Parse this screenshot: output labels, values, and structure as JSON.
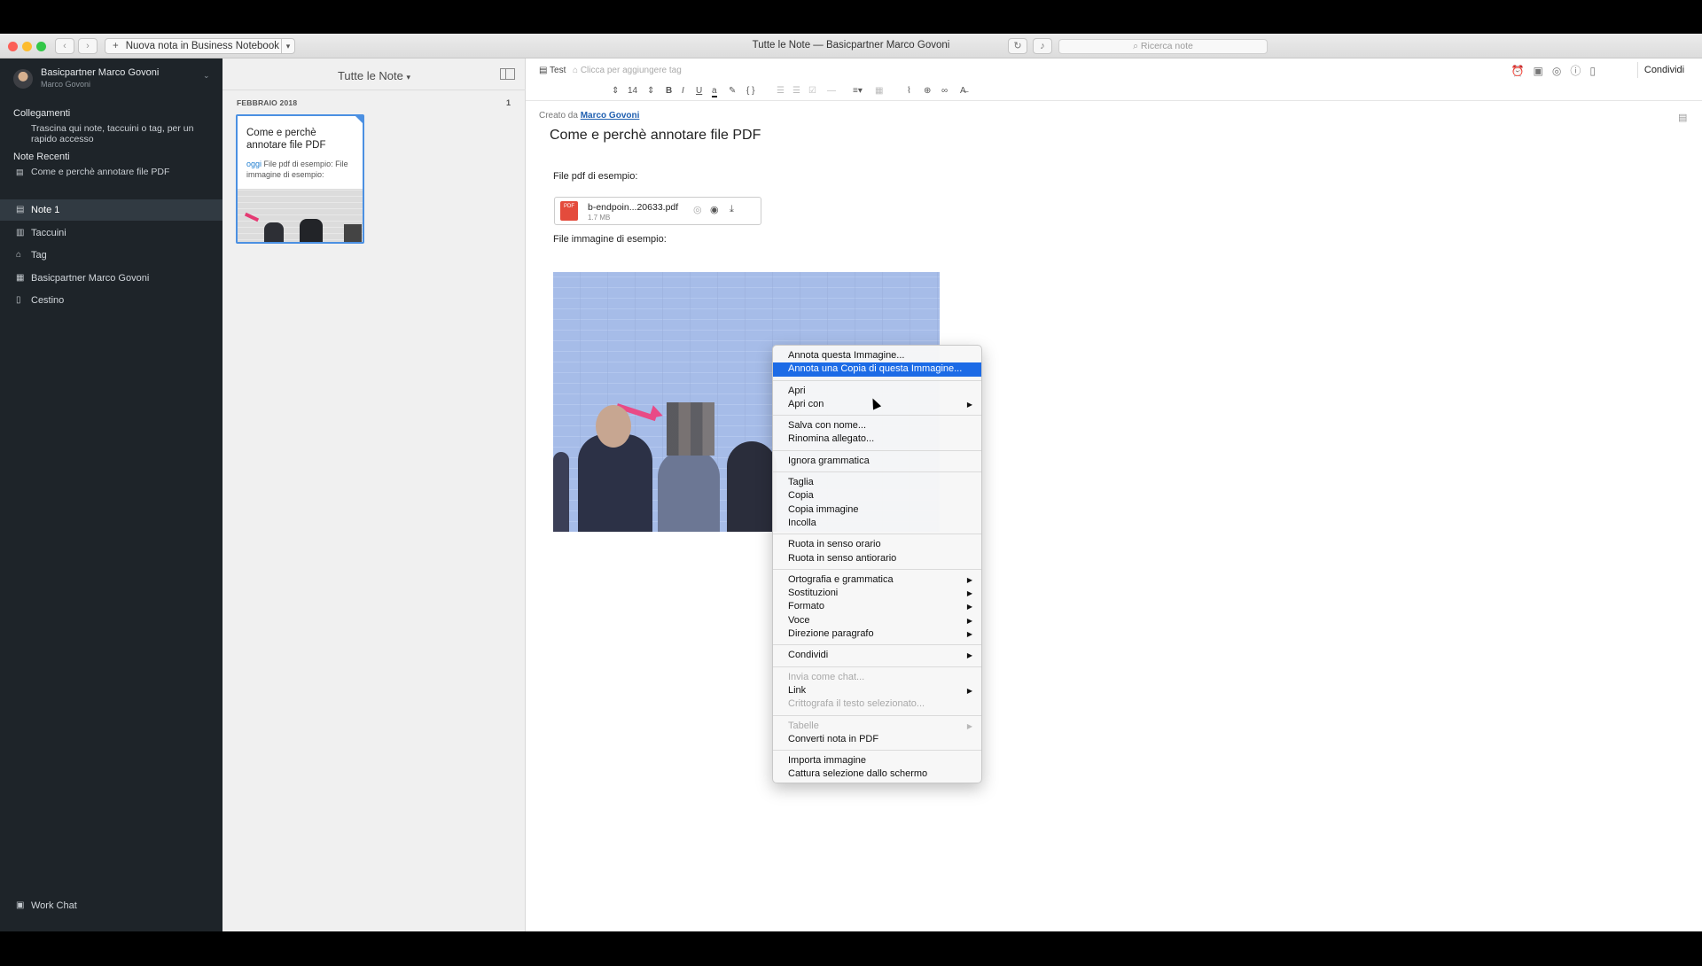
{
  "titlebar": {
    "new_note_label": "Nuova nota in Business Notebook",
    "window_title": "Tutte le Note — Basicpartner Marco Govoni",
    "search_placeholder": "Ricerca note"
  },
  "sidebar": {
    "account_name": "Basicpartner Marco Govoni",
    "account_sub": "Marco Govoni",
    "shortcuts_heading": "Collegamenti",
    "shortcuts_hint": "Trascina qui note, taccuini o tag, per un rapido accesso",
    "recent_heading": "Note Recenti",
    "recent_note": "Come e perchè annotare file PDF",
    "items": [
      {
        "label": "Note 1",
        "icon": "note-icon"
      },
      {
        "label": "Taccuini",
        "icon": "notebook-icon"
      },
      {
        "label": "Tag",
        "icon": "tag-icon"
      },
      {
        "label": "Basicpartner Marco Govoni",
        "icon": "business-icon"
      },
      {
        "label": "Cestino",
        "icon": "trash-icon"
      }
    ],
    "work_chat": "Work Chat"
  },
  "notelist": {
    "title": "Tutte le Note",
    "date_group": "FEBBRAIO 2018",
    "count": "1",
    "card": {
      "title": "Come e perchè annotare file PDF",
      "today": "oggi",
      "snippet": "File pdf di esempio: File immagine di esempio:"
    }
  },
  "editor": {
    "notebook": "Test",
    "tags_placeholder": "Clicca per aggiungere tag",
    "share": "Condividi",
    "font_size": "14",
    "created_by_label": "Creato da",
    "created_by_name": "Marco Govoni",
    "note_title": "Come e perchè annotare file PDF",
    "para1": "File pdf di esempio:",
    "attachment_name": "b-endpoin...20633.pdf",
    "attachment_size": "1.7 MB",
    "para2": "File immagine di esempio:"
  },
  "context_menu": [
    {
      "label": "Annota questa Immagine..."
    },
    {
      "label": "Annota una Copia di questa Immagine...",
      "highlighted": true
    },
    {
      "sep": true
    },
    {
      "label": "Apri"
    },
    {
      "label": "Apri con",
      "sub": true
    },
    {
      "sep": true
    },
    {
      "label": "Salva con nome..."
    },
    {
      "label": "Rinomina allegato..."
    },
    {
      "sep": true
    },
    {
      "label": "Ignora grammatica"
    },
    {
      "sep": true
    },
    {
      "label": "Taglia"
    },
    {
      "label": "Copia"
    },
    {
      "label": "Copia immagine"
    },
    {
      "label": "Incolla"
    },
    {
      "sep": true
    },
    {
      "label": "Ruota in senso orario"
    },
    {
      "label": "Ruota in senso antiorario"
    },
    {
      "sep": true
    },
    {
      "label": "Ortografia e grammatica",
      "sub": true
    },
    {
      "label": "Sostituzioni",
      "sub": true
    },
    {
      "label": "Formato",
      "sub": true
    },
    {
      "label": "Voce",
      "sub": true
    },
    {
      "label": "Direzione paragrafo",
      "sub": true
    },
    {
      "sep": true
    },
    {
      "label": "Condividi",
      "sub": true
    },
    {
      "sep": true
    },
    {
      "label": "Invia come chat...",
      "disabled": true
    },
    {
      "label": "Link",
      "sub": true
    },
    {
      "label": "Crittografa il testo selezionato...",
      "disabled": true
    },
    {
      "sep": true
    },
    {
      "label": "Tabelle",
      "sub": true,
      "disabled": true
    },
    {
      "label": "Converti nota in PDF"
    },
    {
      "sep": true
    },
    {
      "label": "Importa immagine"
    },
    {
      "label": "Cattura selezione dallo schermo"
    }
  ]
}
